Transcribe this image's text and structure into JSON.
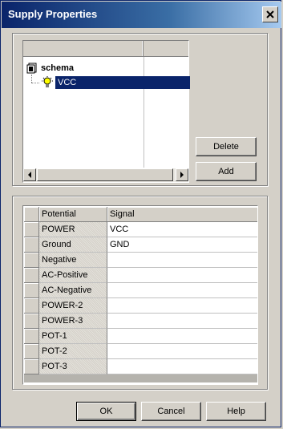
{
  "window": {
    "title": "Supply Properties"
  },
  "tree": {
    "root": "schema",
    "child": "VCC"
  },
  "buttons": {
    "delete": "Delete",
    "add": "Add",
    "ok": "OK",
    "cancel": "Cancel",
    "help": "Help"
  },
  "grid": {
    "columns": [
      "Potential",
      "Signal"
    ],
    "rows": [
      {
        "potential": "POWER",
        "signal": "VCC"
      },
      {
        "potential": "Ground",
        "signal": "GND"
      },
      {
        "potential": "Negative",
        "signal": ""
      },
      {
        "potential": "AC-Positive",
        "signal": ""
      },
      {
        "potential": "AC-Negative",
        "signal": ""
      },
      {
        "potential": "POWER-2",
        "signal": ""
      },
      {
        "potential": "POWER-3",
        "signal": ""
      },
      {
        "potential": "POT-1",
        "signal": ""
      },
      {
        "potential": "POT-2",
        "signal": ""
      },
      {
        "potential": "POT-3",
        "signal": ""
      }
    ]
  },
  "icons": {
    "root": "schema-icon",
    "child": "bulb-icon",
    "close": "close-icon"
  }
}
